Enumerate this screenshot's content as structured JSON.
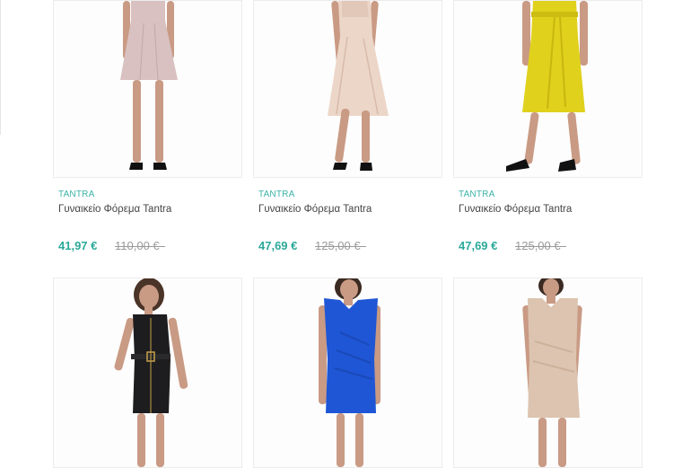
{
  "products": [
    {
      "brand": "TANTRA",
      "name": "Γυναικείο Φόρεμα Tantra",
      "price": "41,97 €",
      "old_price": "110,00 €",
      "image_icon": "dress-photo",
      "dress_color": "#d8c1c0",
      "style": "aline"
    },
    {
      "brand": "TANTRA",
      "name": "Γυναικείο Φόρεμα Tantra",
      "price": "47,69 €",
      "old_price": "125,00 €",
      "image_icon": "dress-photo",
      "dress_color": "#ecd6c8",
      "style": "slip"
    },
    {
      "brand": "TANTRA",
      "name": "Γυναικείο Φόρεμα Tantra",
      "price": "47,69 €",
      "old_price": "125,00 €",
      "image_icon": "dress-photo",
      "dress_color": "#e0d11c",
      "style": "slip"
    },
    {
      "image_icon": "dress-photo",
      "dress_color": "#1d1d1f",
      "style": "zip"
    },
    {
      "image_icon": "dress-photo",
      "dress_color": "#1f56d6",
      "style": "bodycon"
    },
    {
      "image_icon": "dress-photo",
      "dress_color": "#dcc4b0",
      "style": "bodycon"
    }
  ]
}
